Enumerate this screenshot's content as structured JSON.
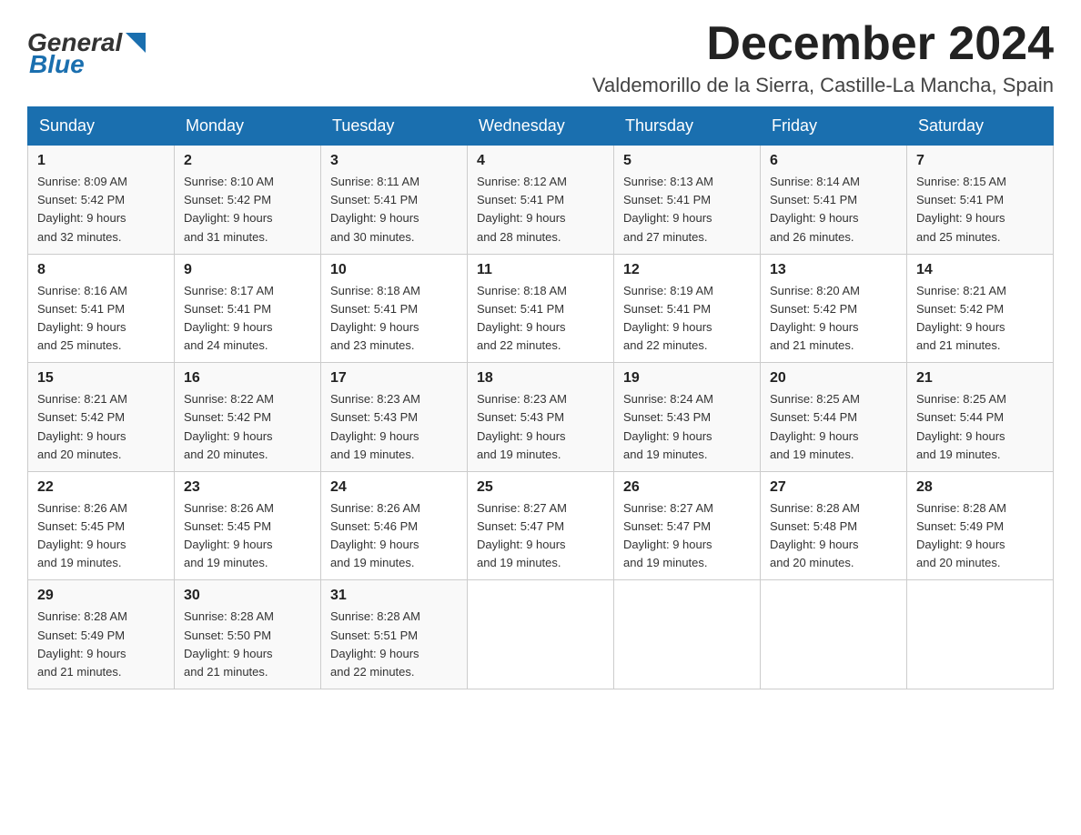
{
  "header": {
    "logo_general": "General",
    "logo_blue": "Blue",
    "month_title": "December 2024",
    "location": "Valdemorillo de la Sierra, Castille-La Mancha, Spain"
  },
  "days_of_week": [
    "Sunday",
    "Monday",
    "Tuesday",
    "Wednesday",
    "Thursday",
    "Friday",
    "Saturday"
  ],
  "weeks": [
    [
      {
        "day": "1",
        "sunrise": "8:09 AM",
        "sunset": "5:42 PM",
        "daylight": "9 hours and 32 minutes."
      },
      {
        "day": "2",
        "sunrise": "8:10 AM",
        "sunset": "5:42 PM",
        "daylight": "9 hours and 31 minutes."
      },
      {
        "day": "3",
        "sunrise": "8:11 AM",
        "sunset": "5:41 PM",
        "daylight": "9 hours and 30 minutes."
      },
      {
        "day": "4",
        "sunrise": "8:12 AM",
        "sunset": "5:41 PM",
        "daylight": "9 hours and 28 minutes."
      },
      {
        "day": "5",
        "sunrise": "8:13 AM",
        "sunset": "5:41 PM",
        "daylight": "9 hours and 27 minutes."
      },
      {
        "day": "6",
        "sunrise": "8:14 AM",
        "sunset": "5:41 PM",
        "daylight": "9 hours and 26 minutes."
      },
      {
        "day": "7",
        "sunrise": "8:15 AM",
        "sunset": "5:41 PM",
        "daylight": "9 hours and 25 minutes."
      }
    ],
    [
      {
        "day": "8",
        "sunrise": "8:16 AM",
        "sunset": "5:41 PM",
        "daylight": "9 hours and 25 minutes."
      },
      {
        "day": "9",
        "sunrise": "8:17 AM",
        "sunset": "5:41 PM",
        "daylight": "9 hours and 24 minutes."
      },
      {
        "day": "10",
        "sunrise": "8:18 AM",
        "sunset": "5:41 PM",
        "daylight": "9 hours and 23 minutes."
      },
      {
        "day": "11",
        "sunrise": "8:18 AM",
        "sunset": "5:41 PM",
        "daylight": "9 hours and 22 minutes."
      },
      {
        "day": "12",
        "sunrise": "8:19 AM",
        "sunset": "5:41 PM",
        "daylight": "9 hours and 22 minutes."
      },
      {
        "day": "13",
        "sunrise": "8:20 AM",
        "sunset": "5:42 PM",
        "daylight": "9 hours and 21 minutes."
      },
      {
        "day": "14",
        "sunrise": "8:21 AM",
        "sunset": "5:42 PM",
        "daylight": "9 hours and 21 minutes."
      }
    ],
    [
      {
        "day": "15",
        "sunrise": "8:21 AM",
        "sunset": "5:42 PM",
        "daylight": "9 hours and 20 minutes."
      },
      {
        "day": "16",
        "sunrise": "8:22 AM",
        "sunset": "5:42 PM",
        "daylight": "9 hours and 20 minutes."
      },
      {
        "day": "17",
        "sunrise": "8:23 AM",
        "sunset": "5:43 PM",
        "daylight": "9 hours and 19 minutes."
      },
      {
        "day": "18",
        "sunrise": "8:23 AM",
        "sunset": "5:43 PM",
        "daylight": "9 hours and 19 minutes."
      },
      {
        "day": "19",
        "sunrise": "8:24 AM",
        "sunset": "5:43 PM",
        "daylight": "9 hours and 19 minutes."
      },
      {
        "day": "20",
        "sunrise": "8:25 AM",
        "sunset": "5:44 PM",
        "daylight": "9 hours and 19 minutes."
      },
      {
        "day": "21",
        "sunrise": "8:25 AM",
        "sunset": "5:44 PM",
        "daylight": "9 hours and 19 minutes."
      }
    ],
    [
      {
        "day": "22",
        "sunrise": "8:26 AM",
        "sunset": "5:45 PM",
        "daylight": "9 hours and 19 minutes."
      },
      {
        "day": "23",
        "sunrise": "8:26 AM",
        "sunset": "5:45 PM",
        "daylight": "9 hours and 19 minutes."
      },
      {
        "day": "24",
        "sunrise": "8:26 AM",
        "sunset": "5:46 PM",
        "daylight": "9 hours and 19 minutes."
      },
      {
        "day": "25",
        "sunrise": "8:27 AM",
        "sunset": "5:47 PM",
        "daylight": "9 hours and 19 minutes."
      },
      {
        "day": "26",
        "sunrise": "8:27 AM",
        "sunset": "5:47 PM",
        "daylight": "9 hours and 19 minutes."
      },
      {
        "day": "27",
        "sunrise": "8:28 AM",
        "sunset": "5:48 PM",
        "daylight": "9 hours and 20 minutes."
      },
      {
        "day": "28",
        "sunrise": "8:28 AM",
        "sunset": "5:49 PM",
        "daylight": "9 hours and 20 minutes."
      }
    ],
    [
      {
        "day": "29",
        "sunrise": "8:28 AM",
        "sunset": "5:49 PM",
        "daylight": "9 hours and 21 minutes."
      },
      {
        "day": "30",
        "sunrise": "8:28 AM",
        "sunset": "5:50 PM",
        "daylight": "9 hours and 21 minutes."
      },
      {
        "day": "31",
        "sunrise": "8:28 AM",
        "sunset": "5:51 PM",
        "daylight": "9 hours and 22 minutes."
      },
      null,
      null,
      null,
      null
    ]
  ]
}
